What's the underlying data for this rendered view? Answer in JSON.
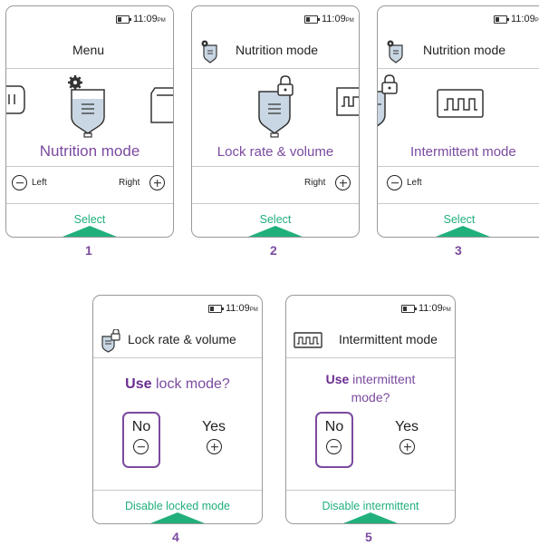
{
  "colors": {
    "accent": "#7b4aa0",
    "action": "#21b07c"
  },
  "screens": [
    {
      "step": "1",
      "time": "11:09",
      "ampm": "PM",
      "title": "Menu",
      "main_label": "Nutrition mode",
      "left_label": "Left",
      "right_label": "Right",
      "bottom_label": "Select",
      "icons": [
        "bag-gear-icon"
      ]
    },
    {
      "step": "2",
      "time": "11:09",
      "ampm": "PM",
      "title": "Nutrition mode",
      "main_label": "Lock rate & volume",
      "right_label": "Right",
      "bottom_label": "Select",
      "icons": [
        "bag-lock-icon"
      ]
    },
    {
      "step": "3",
      "time": "11:09",
      "ampm": "PM",
      "title": "Nutrition mode",
      "main_label": "Intermittent mode",
      "left_label": "Left",
      "bottom_label": "Select",
      "icons": [
        "pulse-icon"
      ]
    },
    {
      "step": "4",
      "time": "11:09",
      "ampm": "PM",
      "title": "Lock rate & volume",
      "question_bold": "Use",
      "question_rest": "lock mode?",
      "option_no": "No",
      "option_yes": "Yes",
      "bottom_label": "Disable locked mode"
    },
    {
      "step": "5",
      "time": "11:09",
      "ampm": "PM",
      "title": "Intermittent mode",
      "question_bold": "Use",
      "question_rest": "intermittent mode?",
      "option_no": "No",
      "option_yes": "Yes",
      "bottom_label": "Disable intermittent"
    }
  ]
}
